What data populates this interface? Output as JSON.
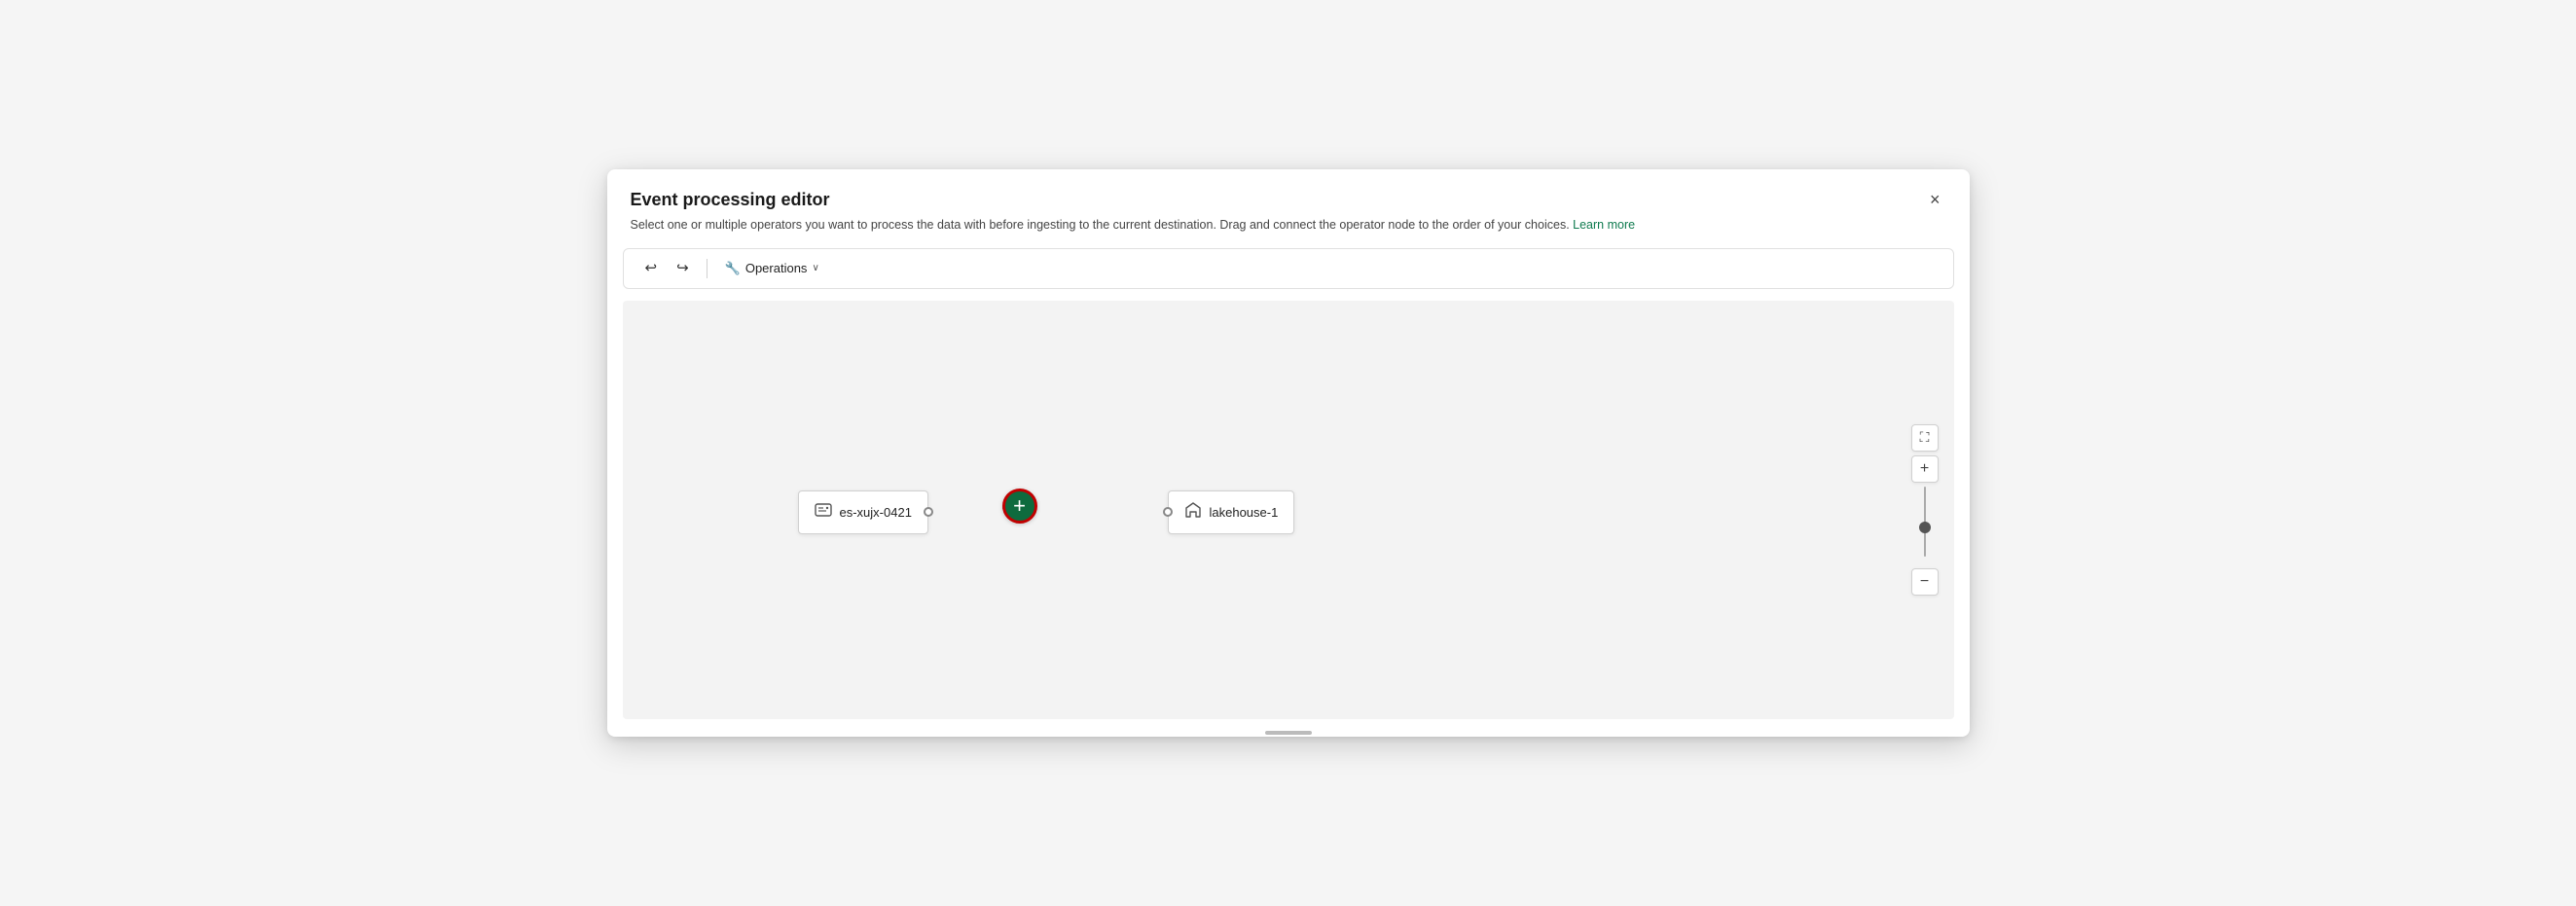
{
  "dialog": {
    "title": "Event processing editor",
    "subtitle": "Select one or multiple operators you want to process the data with before ingesting to the current destination. Drag and connect the operator node to the order of your choices.",
    "learn_more_label": "Learn more",
    "close_label": "×"
  },
  "toolbar": {
    "undo_label": "↩",
    "redo_label": "↪",
    "operations_label": "Operations",
    "chevron_label": "∨"
  },
  "canvas": {
    "source_node": {
      "label": "es-xujx-0421",
      "icon": "⚙"
    },
    "add_button_label": "+",
    "destination_node": {
      "label": "lakehouse-1",
      "icon": "⌂"
    }
  },
  "zoom_controls": {
    "fit_icon": "⛶",
    "zoom_in_label": "+",
    "zoom_out_label": "−"
  }
}
